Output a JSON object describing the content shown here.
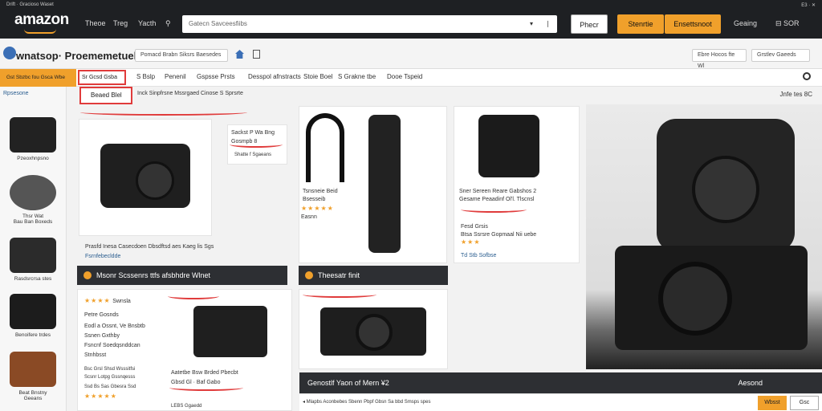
{
  "topbar": {
    "tiny_left": "Drift · Gracioso Waset",
    "tiny_right": "E3 · ✕",
    "logo": "amazon",
    "nav": [
      "Theoe",
      "Treg",
      "Yacth",
      "⚲"
    ],
    "search_placeholder": "Gatecn Savceesfiibs",
    "search_dropdown": "▾",
    "search_cursor": "❘",
    "btn_primary": "Phecr",
    "btn_yellow_1": "Stenrtie",
    "btn_yellow_2": "Ensettsnoot",
    "link_1": "Geaing",
    "link_2": "⊟ SOR"
  },
  "subheader": {
    "brand": "wnatsop·  Proememetuek",
    "breadcrumb": "Pomacd Brabn Siksrs Baesedes",
    "pill_r1": "Ebre Hocos fte Wl",
    "pill_r2": "Grstlev Gaeeds"
  },
  "categories": {
    "badge": "Gst Sbzbc fou Gsca Wbe",
    "items": [
      "Sr Gcsd Gsba",
      "S Bslp",
      "Penenil",
      "Gspsse Prsts",
      "Desspol afnstracts",
      "Stoie Boel",
      "S Grakne tbe",
      "Dooe Tspeid"
    ],
    "search_icon": "search-icon"
  },
  "filterbar": {
    "tab": "Beaed Blel",
    "sort_text": "Inck Sinpfrsne Mssrgaed Cinose S Sprsrte",
    "results": "Jnfe tes  8C"
  },
  "sidebar": {
    "title": "Rpsesone",
    "items": [
      "Pzeoxhnpsno",
      "Thsr Wat\nBau Ban Boxeds",
      "Rasdsrcrsa stes",
      "Benoifere trdes",
      "Beat Bnstny\nGeeans"
    ]
  },
  "card1": {
    "info_title": "Sackst P Wa Bng",
    "info_sub": "Gosmpb 8",
    "info_note": "Shatte f Sgaeans",
    "caption": "Prasfd Inesa Casecdoen Dbsdftsd aes Kaeg lis Sgs",
    "link": "Fsrnfebecldde"
  },
  "card2": {
    "title": "Tsnsneie Beid",
    "sub": "Bsesseib",
    "stars": "★★★★★",
    "reviews": "Easnn"
  },
  "card3": {
    "title": "Sner Sereen Reare Gabshos 2",
    "sub": "Gesame Peaadinf Ol'l. Tlscnsl",
    "line1": "Fesd Grsis",
    "line2": "Btsa Ssrsre Gopmaal Nii uebe",
    "stars": "★★★",
    "link": "Td Stb Sofbse"
  },
  "bars": {
    "bar1": "Msonr Scssenrs ttfs afsbhdre Wlnet",
    "bar2": "Theesatr finit"
  },
  "card4": {
    "stars": "★★★★",
    "stars_label": "Swnsla",
    "lines": [
      "Petre Gosnds",
      "Eodl a Ossnt, Ve Bnsbtb",
      "Ssnen Gxthby",
      "Fsncnf Soedqsnddcan",
      "Stnhbsst"
    ],
    "small1": "Bsc Grsl Shsd Wsssitfsi",
    "small2": "Scsnr Lotpg Gssnqesss",
    "small3": "Ssd Bs Sas Gbesra Ssd",
    "stars2": "★★★★★"
  },
  "card5": {
    "title": "Aatetbe Bsw Brded Pbecbt",
    "sub": "Gbsd Gl · Baf Gabo",
    "note": "LEBS Ggaedd"
  },
  "bottom": {
    "title": "Genostlf Yaon of Mern ¥2",
    "right": "Aesond",
    "strip_text": "◂  Mlapbs Aconbebes Sbenn Pbpf Gbsn Sa bbd Smsps spes",
    "btn1": "Wbsst",
    "btn2": "Gsc"
  },
  "colors": {
    "accent_yellow": "#f0a02b",
    "highlight_red": "#e03b3b",
    "dark_bar": "#2d2f33",
    "top_bar": "#1e2023"
  }
}
